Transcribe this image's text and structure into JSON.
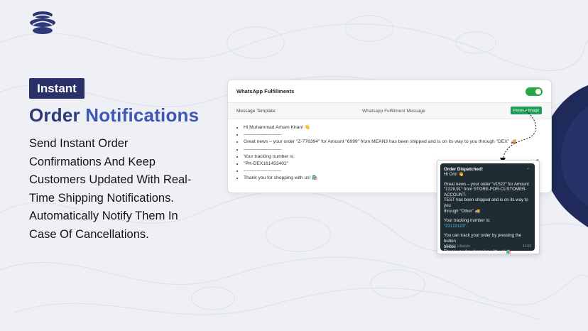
{
  "brand": {
    "logo_icon": "mean3-logo-icon"
  },
  "hero": {
    "badge": "Instant",
    "headline_word1": "Order",
    "headline_word2": "Notifications",
    "description_lines": [
      "Send Instant Order",
      "Confirmations And Keep",
      "Customers Updated With Real-",
      "Time Shipping Notifications.",
      "Automatically Notify Them In",
      "Case Of Cancellations."
    ]
  },
  "panel": {
    "title": "WhatsApp Fulfillments",
    "toggle_on": true,
    "template_label": "Message Template:",
    "template_value": "Whatsapp Fulfillment Message",
    "preview_button": "Preview Image",
    "lines": [
      "Hi Muhammad Arham Khan! 👋",
      "------------------------",
      "Great news – your order \"Z-776394\" for Amount \"6999\" from MEAN3 has been shipped and is on its way to you through \"DEX\" 🚚",
      "------------------------",
      "Your tracking number is:",
      "\"PK-DEX161453402\"",
      "------------------------",
      "Thank you for shopping with us! 🛍️"
    ]
  },
  "whatsapp_preview": {
    "title": "Order Dispatched!",
    "greeting": "Hi Om! 👋",
    "body_lines": [
      "Great news – your order \"#1522\" for Amount",
      "\"1229.91\" from STORE-FOR-CUSTOMER-ACCOUNT-",
      "TEST has been shipped and is on its way to you",
      "through \"Other\" 🚚"
    ],
    "tracking_label": "Your tracking number is:",
    "tracking_number": "\"23123123\".",
    "track_lines": [
      "You can track your order by pressing the button",
      "below."
    ],
    "thanks": "Thank you for shopping with us! 🛍️",
    "footer": "MEAN3 Lifestyle",
    "time": "11:09",
    "close_icon": "×",
    "chevron_icon": "⌄"
  },
  "colors": {
    "background": "#eef0f6",
    "badge": "#2a3168",
    "headline": "#2e3a78",
    "accent": "#3e57b5",
    "toggle": "#28a745",
    "button": "#1e9e55",
    "whatsapp_dark": "#1f2c34"
  }
}
